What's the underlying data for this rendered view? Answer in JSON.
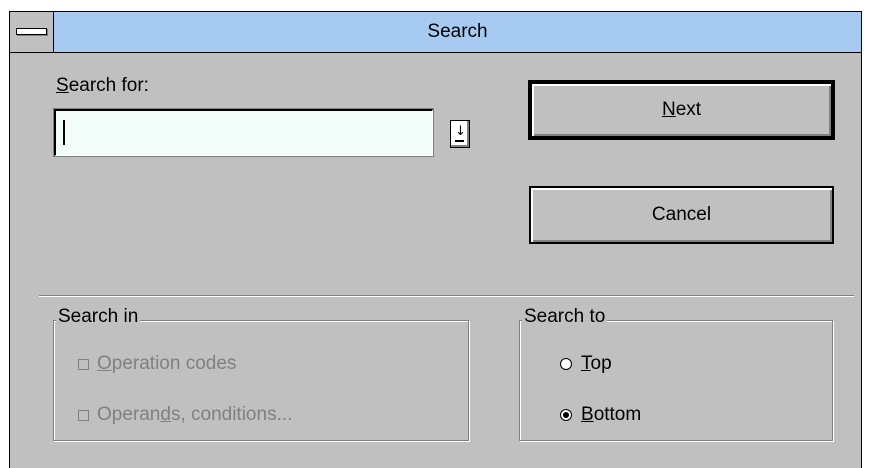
{
  "window": {
    "title": "Search"
  },
  "search_for": {
    "label": "Search for:",
    "label_mnemonic": "S",
    "label_rest": "earch for:",
    "value": ""
  },
  "buttons": {
    "next": {
      "mnemonic": "N",
      "rest": "ext"
    },
    "cancel": {
      "label": "Cancel"
    }
  },
  "search_in": {
    "title": "Search in",
    "options": [
      {
        "pre": "",
        "mnemonic": "O",
        "post": "peration codes",
        "checked": false,
        "enabled": false
      },
      {
        "pre": "Operan",
        "mnemonic": "d",
        "post": "s, conditions...",
        "checked": false,
        "enabled": false
      }
    ]
  },
  "search_to": {
    "title": "Search to",
    "options": [
      {
        "pre": "",
        "mnemonic": "T",
        "post": "op",
        "selected": false
      },
      {
        "pre": "",
        "mnemonic": "B",
        "post": "ottom",
        "selected": true
      }
    ]
  },
  "colors": {
    "titlebar": "#a6caf0",
    "face": "#c0c0c0",
    "field": "#f2fcf8",
    "disabled_text": "#808080"
  },
  "icons": {
    "system_menu": "system-menu-bar",
    "dropdown": "down-arrow-icon"
  }
}
